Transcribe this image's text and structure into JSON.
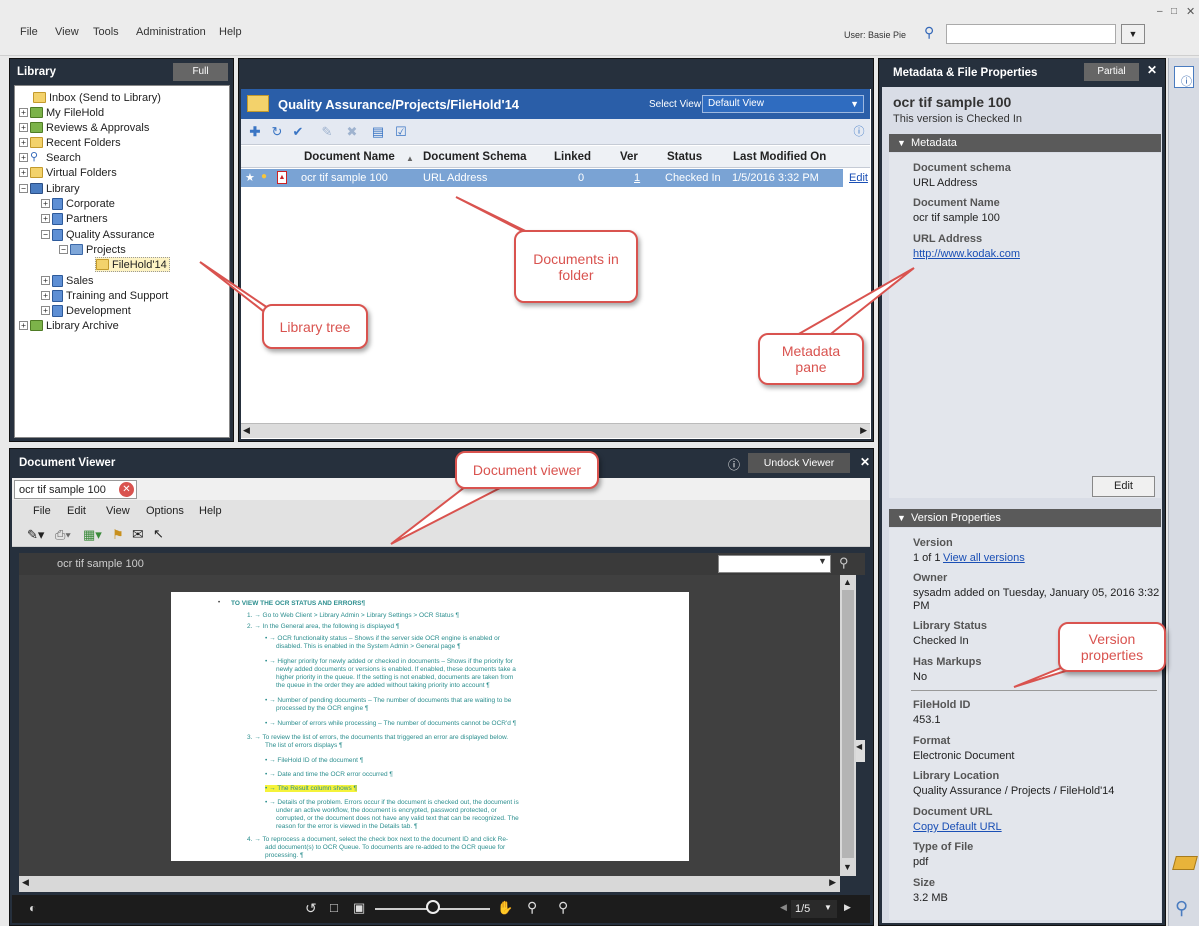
{
  "menubar": {
    "items": [
      "File",
      "View",
      "Tools",
      "Administration",
      "Help"
    ],
    "user_label": "User: Basie Pie",
    "search_value": ""
  },
  "library": {
    "title": "Library",
    "full_button": "Full",
    "tree": [
      {
        "label": "Inbox (Send to Library)",
        "icon": "folder-icon"
      },
      {
        "label": "My FileHold",
        "icon": "users-icon"
      },
      {
        "label": "Reviews & Approvals",
        "icon": "check-icon"
      },
      {
        "label": "Recent Folders",
        "icon": "folder-icon"
      },
      {
        "label": "Search",
        "icon": "search-icon"
      },
      {
        "label": "Virtual Folders",
        "icon": "folder-icon"
      },
      {
        "label": "Library",
        "icon": "library-icon"
      },
      {
        "label": "Corporate",
        "icon": "cabinet-icon"
      },
      {
        "label": "Partners",
        "icon": "cabinet-icon"
      },
      {
        "label": "Quality Assurance",
        "icon": "cabinet-icon"
      },
      {
        "label": "Projects",
        "icon": "drawer-icon"
      },
      {
        "label": "FileHold'14",
        "icon": "folder-icon"
      },
      {
        "label": "Sales",
        "icon": "cabinet-icon"
      },
      {
        "label": "Training and Support",
        "icon": "cabinet-icon"
      },
      {
        "label": "Development",
        "icon": "cabinet-icon"
      },
      {
        "label": "Library Archive",
        "icon": "archive-icon"
      }
    ]
  },
  "folder": {
    "path": "Quality Assurance/Projects/FileHold'14",
    "select_view_label": "Select View:",
    "select_view_value": "Default View",
    "columns": [
      "Document Name",
      "Document Schema",
      "Linked",
      "Ver",
      "Status",
      "Last Modified On"
    ],
    "rows": [
      {
        "name": "ocr tif sample 100",
        "schema": "URL Address",
        "linked": "0",
        "ver": "1",
        "status": "Checked In",
        "modified": "1/5/2016 3:32 PM",
        "action": "Edit"
      }
    ]
  },
  "metadata": {
    "title": "Metadata & File Properties",
    "partial_button": "Partial",
    "doc_title": "ocr tif sample 100",
    "doc_status": "This version is Checked In",
    "section_metadata": "Metadata",
    "fields": [
      {
        "label": "Document schema",
        "value": "URL Address"
      },
      {
        "label": "Document Name",
        "value": "ocr tif sample 100"
      },
      {
        "label": "URL Address",
        "value": "http://www.kodak.com"
      }
    ],
    "edit_button": "Edit",
    "section_version": "Version Properties",
    "version_label": "Version",
    "version_value": "1 of 1",
    "view_all_versions": "View all versions",
    "owner_label": "Owner",
    "owner_value_1": "sysadm added on Tuesday, January 05, 2016 3:32",
    "owner_value_2": "PM",
    "library_status_label": "Library Status",
    "library_status_value": "Checked In",
    "has_markups_label": "Has Markups",
    "has_markups_value": "No",
    "filehold_id_label": "FileHold ID",
    "filehold_id_value": "453.1",
    "format_label": "Format",
    "format_value": "Electronic Document",
    "library_location_label": "Library Location",
    "library_location_value": "Quality Assurance / Projects / FileHold'14",
    "document_url_label": "Document URL",
    "document_url_value": "Copy Default URL",
    "type_label": "Type of File",
    "type_value": "pdf",
    "size_label": "Size",
    "size_value": "3.2 MB"
  },
  "viewer": {
    "title": "Document Viewer",
    "undock_button": "Undock Viewer",
    "tab_label": "ocr tif sample 100",
    "menu": [
      "File",
      "Edit",
      "View",
      "Options",
      "Help"
    ],
    "doc_label": "ocr tif sample 100",
    "page_indicator": "1/5",
    "content": {
      "heading": "TO VIEW THE OCR STATUS AND ERRORS¶",
      "lines": [
        "1. → Go to Web Client > Library Admin > Library Settings > OCR Status ¶",
        "2. → In the General area, the following is displayed ¶",
        "• → OCR functionality status – Shows if the server side OCR engine is enabled or",
        "disabled. This is enabled in the System Admin > General page ¶",
        "• → Higher priority for newly added or checked in documents – Shows if the priority for",
        "newly added documents or versions is enabled. If enabled, these documents take a",
        "higher priority in the queue. If the setting is not enabled, documents are taken from",
        "the queue in the order they are added without taking priority into account ¶",
        "• → Number of pending documents – The number of documents that are waiting to be",
        "processed by the OCR engine ¶",
        "• → Number of errors while processing – The number of documents cannot be OCR'd ¶",
        "3. → To review the list of errors, the documents that triggered an error are displayed below.",
        "The list of errors displays ¶",
        "• → FileHold ID of the document ¶",
        "• → Date and time the OCR error occurred ¶",
        "• → The Result column shows ¶",
        "• → Details of the problem. Errors occur if the document is checked out, the document is",
        "under an active workflow, the document is encrypted, password protected, or",
        "corrupted, or the document does not have any valid text that can be recognized. The",
        "reason for the error is viewed in the Details tab. ¶",
        "4. → To reprocess a document, select the check box next to the document ID and click Re-",
        "add document(s) to OCR Queue. To documents are re-added to the OCR queue for",
        "processing. ¶"
      ]
    }
  },
  "callouts": {
    "library_tree": "Library tree",
    "documents_in_folder_1": "Documents in",
    "documents_in_folder_2": "folder",
    "metadata_pane_1": "Metadata",
    "metadata_pane_2": "pane",
    "document_viewer": "Document viewer",
    "version_properties_1": "Version",
    "version_properties_2": "properties"
  },
  "colors": {
    "panel_header": "#26303d",
    "selection_row": "#7aa3d4",
    "folder_header": "#2a5ea8",
    "callout_border": "#d9534f",
    "doc_text": "#2b8e8e"
  }
}
